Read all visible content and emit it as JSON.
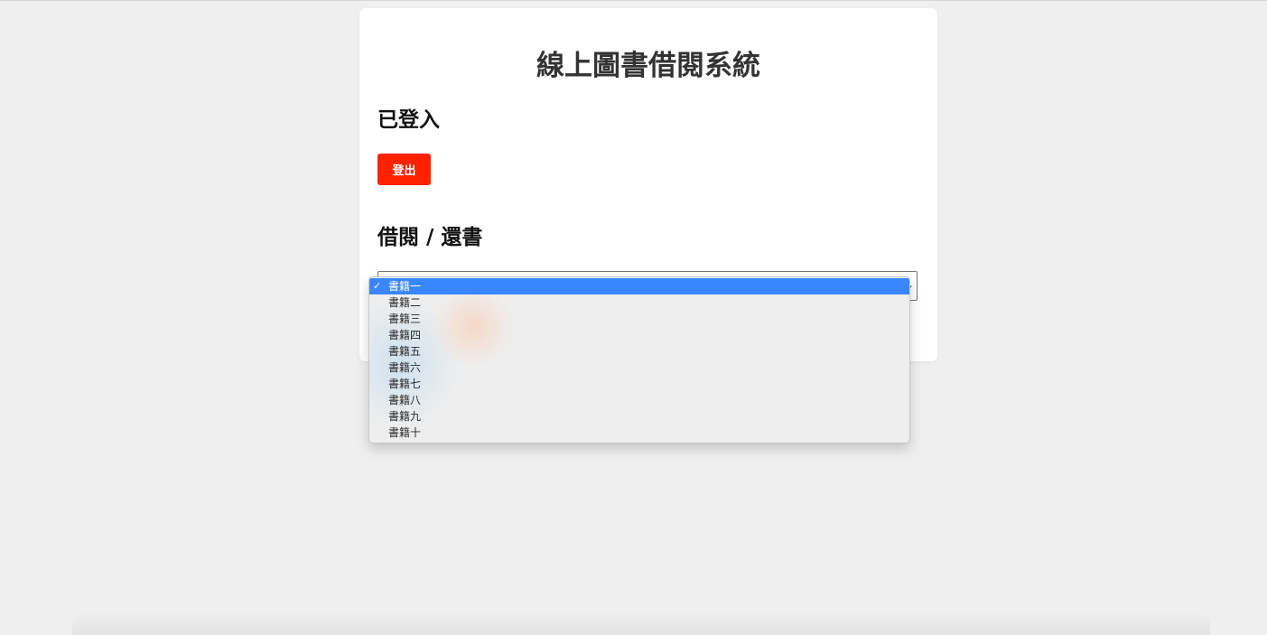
{
  "app": {
    "title": "線上圖書借閱系統"
  },
  "auth": {
    "status_text": "已登入",
    "logout_label": "登出",
    "logout_color": "#ff2200"
  },
  "borrow": {
    "heading": "借閱 / 還書",
    "select": {
      "selected_value": "書籍一",
      "chevron_icon": "chevron-down-icon",
      "options": [
        {
          "label": "書籍一",
          "selected": true
        },
        {
          "label": "書籍二",
          "selected": false
        },
        {
          "label": "書籍三",
          "selected": false
        },
        {
          "label": "書籍四",
          "selected": false
        },
        {
          "label": "書籍五",
          "selected": false
        },
        {
          "label": "書籍六",
          "selected": false
        },
        {
          "label": "書籍七",
          "selected": false
        },
        {
          "label": "書籍八",
          "selected": false
        },
        {
          "label": "書籍九",
          "selected": false
        },
        {
          "label": "書籍十",
          "selected": false
        }
      ],
      "highlight_color": "#3a86ff",
      "check_icon": "checkmark-icon"
    }
  },
  "colors": {
    "page_background": "#efefef",
    "card_background": "#ffffff",
    "title_text": "#333333"
  }
}
